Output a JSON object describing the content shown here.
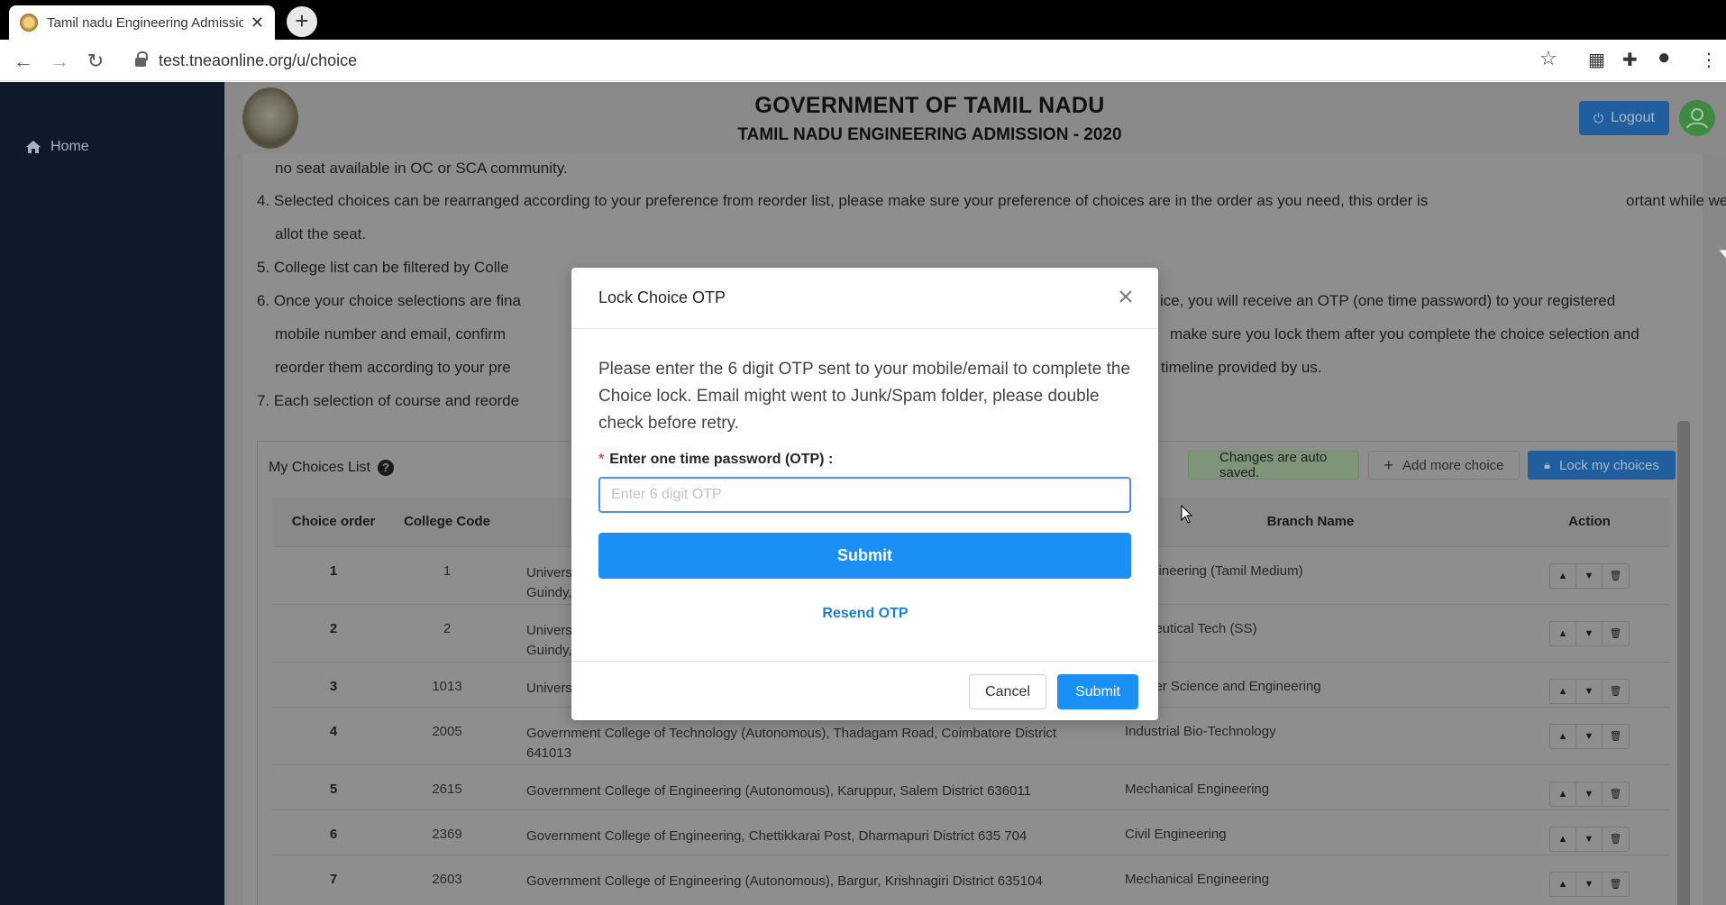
{
  "browser": {
    "tab_title": "Tamil nadu Engineering Admissio",
    "tab_close": "✕",
    "new_tab": "+",
    "url": "test.tneaonline.org/u/choice"
  },
  "sidebar": {
    "home_label": "Home"
  },
  "header": {
    "title": "GOVERNMENT OF TAMIL NADU",
    "subtitle": "TAMIL NADU ENGINEERING ADMISSION - 2020",
    "logout_label": "Logout"
  },
  "instructions": [
    {
      "num": "",
      "text": "no seat available in OC or SCA community."
    },
    {
      "num": "4.",
      "text": "Selected choices can be rearranged according to your preference from reorder list, please make sure your preference of choices are in the order as you need, this order is"
    },
    {
      "num": "",
      "text": "ortant while we"
    },
    {
      "num": "",
      "text": "allot the seat."
    },
    {
      "num": "5.",
      "text": "College list can be filtered by Colle"
    },
    {
      "num": "6.",
      "text": "Once your choice selections are fina"
    },
    {
      "num": "",
      "text": "ice, you will receive an OTP (one time password) to your registered"
    },
    {
      "num": "",
      "text": "mobile number and email, confirm"
    },
    {
      "num": "",
      "text": "make sure you lock them after you complete the choice selection and"
    },
    {
      "num": "",
      "text": "reorder them according to your pre"
    },
    {
      "num": "",
      "text": "timeline provided by us."
    },
    {
      "num": "7.",
      "text": "Each selection of course and reorde"
    }
  ],
  "choices": {
    "heading": "My Choices List",
    "help_icon": "?",
    "auto_saved": "Changes are auto saved.",
    "add_more": "Add more choice",
    "lock": "Lock my choices",
    "columns": {
      "order": "Choice order",
      "code": "College Code",
      "college": "",
      "branch": "Branch Name",
      "action": "Action"
    },
    "rows": [
      {
        "order": "1",
        "code": "1",
        "college": "Univers",
        "college2": "Guindy,",
        "branch": "il Engineering (Tamil Medium)"
      },
      {
        "order": "2",
        "code": "2",
        "college": "Univers",
        "college2": "Guindy,",
        "branch": "rmaceutical Tech (SS)"
      },
      {
        "order": "3",
        "code": "1013",
        "college": "Univers",
        "college2": "",
        "branch": "mputer Science and Engineering"
      },
      {
        "order": "4",
        "code": "2005",
        "college": "Government College of Technology (Autonomous), Thadagam Road, Coimbatore District",
        "college2": "641013",
        "branch": "Industrial Bio-Technology"
      },
      {
        "order": "5",
        "code": "2615",
        "college": "Government College of Engineering (Autonomous), Karuppur, Salem District 636011",
        "college2": "",
        "branch": "Mechanical Engineering"
      },
      {
        "order": "6",
        "code": "2369",
        "college": "Government College of Engineering, Chettikkarai Post, Dharmapuri District 635 704",
        "college2": "",
        "branch": "Civil Engineering"
      },
      {
        "order": "7",
        "code": "2603",
        "college": "Government College of Engineering (Autonomous), Bargur, Krishnagiri District 635104",
        "college2": "",
        "branch": "Mechanical Engineering"
      }
    ]
  },
  "modal": {
    "title": "Lock Choice OTP",
    "message": "Please enter the 6 digit OTP sent to your mobile/email to complete the Choice lock. Email might went to Junk/Spam folder, please double check before retry.",
    "required_mark": "*",
    "label": "Enter one time password (OTP) :",
    "placeholder": "Enter 6 digit OTP",
    "value": "",
    "submit_primary": "Submit",
    "resend": "Resend OTP",
    "cancel": "Cancel",
    "submit_footer": "Submit"
  },
  "colors": {
    "primary": "#1a8ff5",
    "overlay": "#888888",
    "sidebar": "#0e1a2b",
    "arrow": "#00b050"
  }
}
